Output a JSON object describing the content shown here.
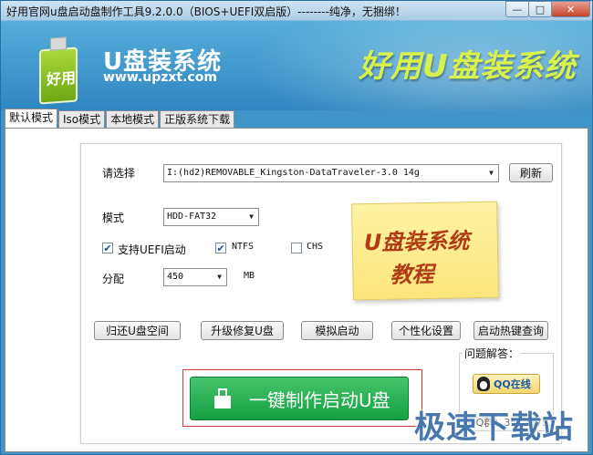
{
  "window": {
    "title": "好用官网u盘启动盘制作工具9.2.0.0（BIOS+UEFI双启版）--------纯净，无捆绑！",
    "minimize": "—",
    "maximize": "□",
    "close": "✕"
  },
  "header": {
    "logo_text": "好用",
    "brand_title": "U盘装系统",
    "brand_url": "www.upzxt.com",
    "slogan": "好用U盘装系统"
  },
  "tabs": [
    {
      "label": "默认模式",
      "active": true
    },
    {
      "label": "Iso模式",
      "active": false
    },
    {
      "label": "本地模式",
      "active": false
    },
    {
      "label": "正版系统下载",
      "active": false
    }
  ],
  "form": {
    "device_label": "请选择",
    "device_value": "I:(hd2)REMOVABLE_Kingston-DataTraveler-3.0 14g",
    "refresh_label": "刷新",
    "mode_label": "模式",
    "mode_value": "HDD-FAT32",
    "uefi_label": "支持UEFI启动",
    "uefi_checked": true,
    "ntfs_label": "NTFS",
    "ntfs_checked": true,
    "chs_label": "CHS",
    "chs_checked": false,
    "partition_label": "分配",
    "partition_value": "450",
    "partition_unit": "MB"
  },
  "note": {
    "line1": "U盘装系统",
    "line2": "教程"
  },
  "actions": [
    {
      "label": "归还U盘空间"
    },
    {
      "label": "升级修复U盘"
    },
    {
      "label": "模拟启动"
    },
    {
      "label": "个性化设置"
    },
    {
      "label": "启动热键查询"
    }
  ],
  "primary": {
    "label": "一键制作启动U盘"
  },
  "help": {
    "title": "问题解答：",
    "qq_label": "QQ在线",
    "qq_number": "QQ群：35121753"
  },
  "watermark": "极速下载站"
}
